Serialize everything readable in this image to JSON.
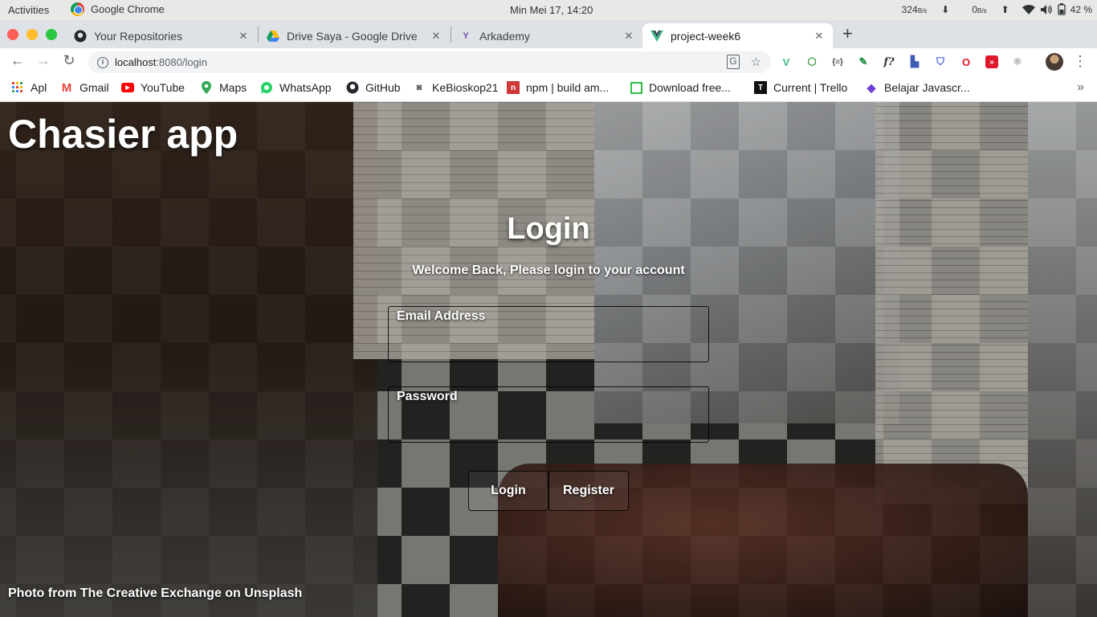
{
  "system_bar": {
    "activities": "Activities",
    "app_name": "Google Chrome",
    "clock": "Min Mei 17, 14:20",
    "download_speed": "324",
    "download_unit": "B/s",
    "upload_speed": "0",
    "upload_unit": "B/s",
    "battery": "42 %"
  },
  "tabs": [
    {
      "title": "Your Repositories",
      "icon": "github-icon"
    },
    {
      "title": "Drive Saya - Google Drive",
      "icon": "google-drive-icon"
    },
    {
      "title": "Arkademy",
      "icon": "arkademy-icon"
    },
    {
      "title": "project-week6",
      "icon": "vue-icon",
      "active": true
    }
  ],
  "address_bar": {
    "host": "localhost",
    "path": ":8080/login"
  },
  "bookmarks": [
    {
      "label": "Apl",
      "icon": "apps-grid-icon"
    },
    {
      "label": "Gmail",
      "icon": "gmail-icon"
    },
    {
      "label": "YouTube",
      "icon": "youtube-icon"
    },
    {
      "label": "Maps",
      "icon": "maps-icon"
    },
    {
      "label": "WhatsApp",
      "icon": "whatsapp-icon"
    },
    {
      "label": "GitHub",
      "icon": "github-icon"
    },
    {
      "label": "KeBioskop21",
      "icon": "kebioskop-icon"
    },
    {
      "label": "npm | build am...",
      "icon": "npm-icon"
    },
    {
      "label": "Download free...",
      "icon": "download-icon"
    },
    {
      "label": "Current | Trello",
      "icon": "trello-icon"
    },
    {
      "label": "Belajar Javascr...",
      "icon": "code-icon"
    }
  ],
  "page": {
    "app_title": "Chasier app",
    "login_title": "Login",
    "welcome": "Welcome Back, Please login to your account",
    "email_label": "Email Address",
    "email_value": "",
    "password_label": "Password",
    "password_value": "",
    "login_button": "Login",
    "register_button": "Register",
    "photo_credit": "Photo from The Creative Exchange on Unsplash"
  },
  "colors": {
    "chrome_tabstrip": "#dee1e6",
    "topbar": "#e8e8e7",
    "text_on_photo": "#ffffff"
  }
}
